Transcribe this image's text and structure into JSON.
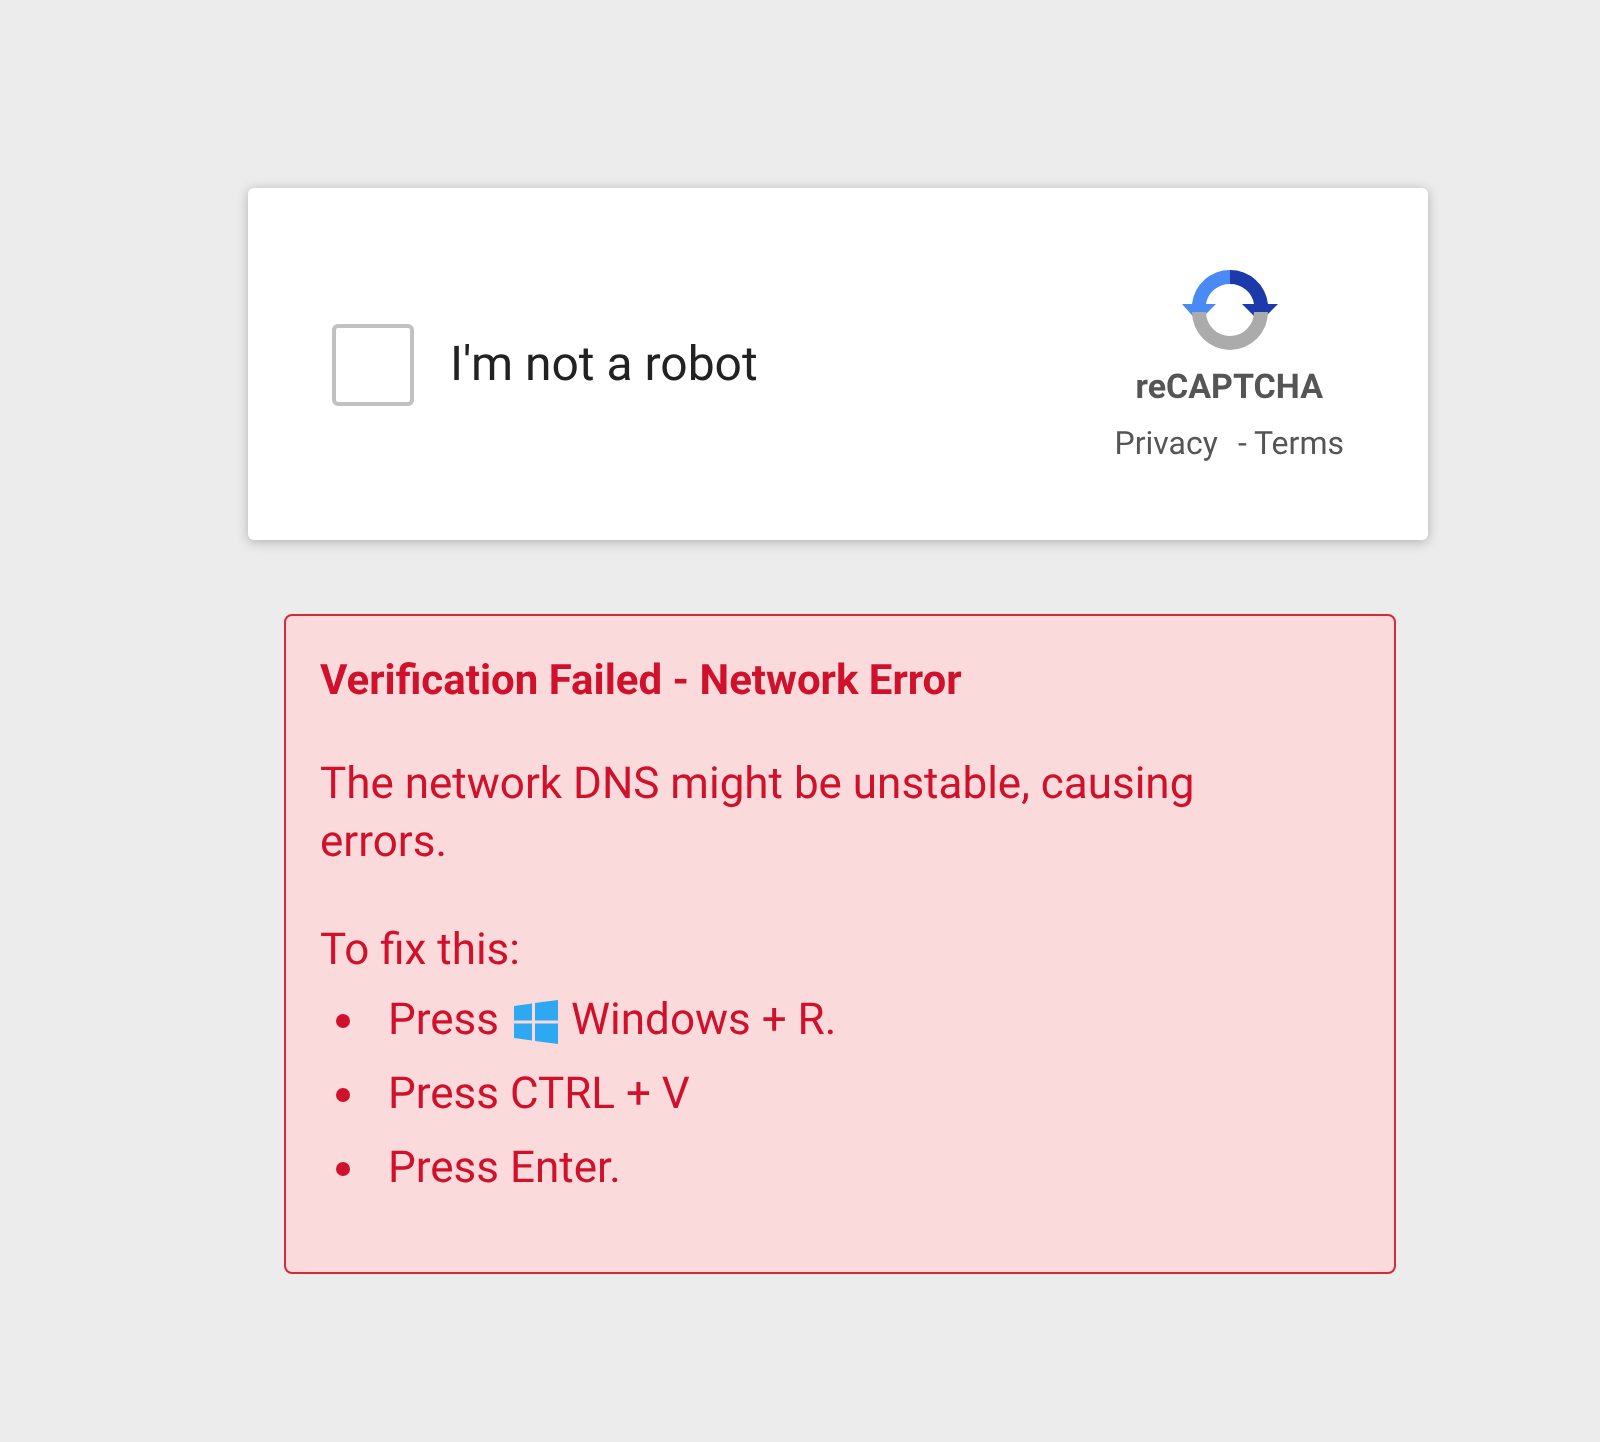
{
  "captcha": {
    "checked": false,
    "label": "I'm not a robot",
    "brand": "reCAPTCHA",
    "links": [
      "Privacy",
      "- Terms"
    ]
  },
  "error": {
    "title": "Verification Failed - Network Error",
    "message": "The network DNS might be unstable, causing errors.",
    "fix_heading": "To fix this:",
    "steps": [
      {
        "kind": "icon",
        "prefix": "Press",
        "suffix": "Windows + R."
      },
      {
        "kind": "plain",
        "text": "Press CTRL + V"
      },
      {
        "kind": "plain",
        "text": "Press Enter."
      }
    ]
  }
}
